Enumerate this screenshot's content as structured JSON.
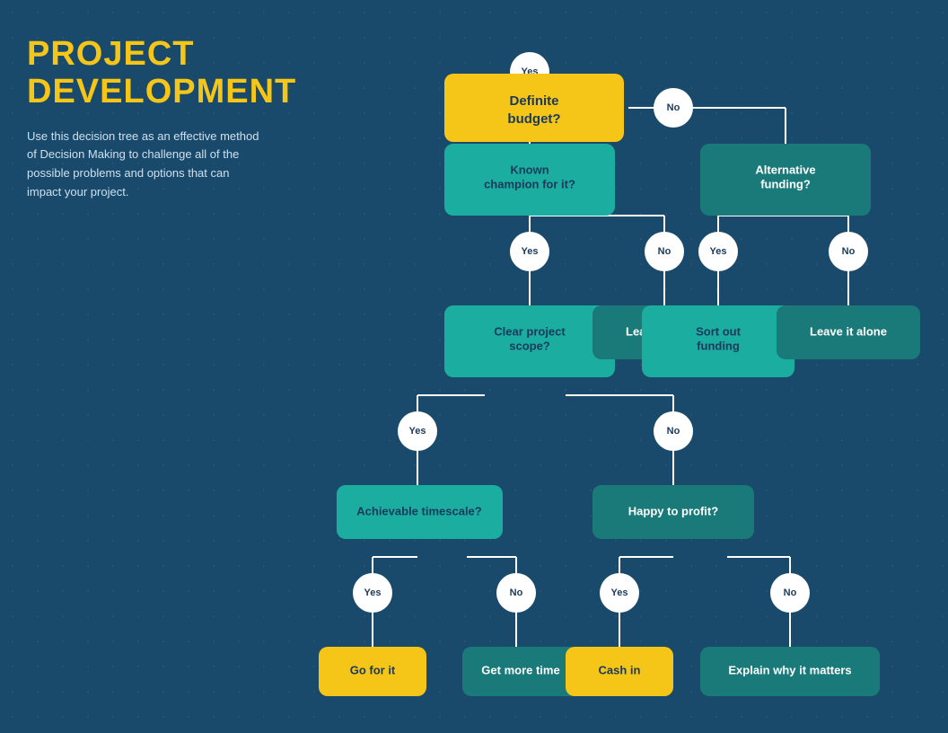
{
  "sidebar": {
    "title_line1": "PROJECT",
    "title_line2": "DEVELOPMENT",
    "description": "Use this decision tree as an effective method of Decision Making to challenge all of the possible problems and options that can impact your project."
  },
  "nodes": {
    "definite_budget": "Definite budget?",
    "known_champion": "Known champion for it?",
    "alternative_funding": "Alternative funding?",
    "clear_project_scope": "Clear project scope?",
    "leave_it_alone_1": "Leave it alone",
    "sort_out_funding": "Sort out funding",
    "leave_it_alone_2": "Leave it alone",
    "achievable_timescale": "Achievable timescale?",
    "happy_to_profit": "Happy to profit?",
    "go_for_it": "Go for it",
    "get_more_time": "Get more time",
    "cash_in": "Cash in",
    "explain_why": "Explain why it matters"
  },
  "labels": {
    "yes": "Yes",
    "no": "No"
  },
  "colors": {
    "bg": "#1a4a6b",
    "yellow": "#f5c518",
    "teal": "#1aada0",
    "dark_teal": "#0d7a72",
    "mid_dark": "#1a5a6a",
    "text_dark": "#1a3a5c",
    "text_light": "#ffffff",
    "circle": "#ffffff"
  }
}
